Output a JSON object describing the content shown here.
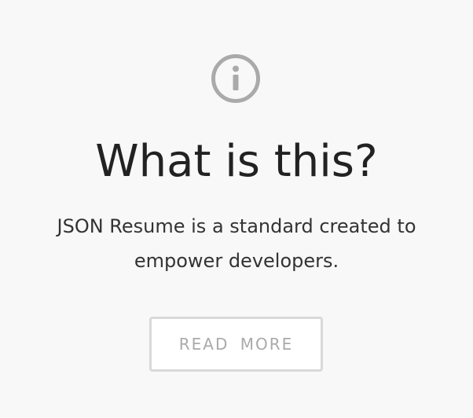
{
  "about": {
    "icon": "info-circle-icon",
    "title": "What is this?",
    "description": "JSON Resume is a standard created to empower developers.",
    "read_more_label": "READ  MORE"
  },
  "colors": {
    "background": "#f8f8f8",
    "icon": "#aaaaaa",
    "title_text": "#222222",
    "body_text": "#333333",
    "button_border": "#d9d9d9",
    "button_text": "#aaaaaa"
  }
}
